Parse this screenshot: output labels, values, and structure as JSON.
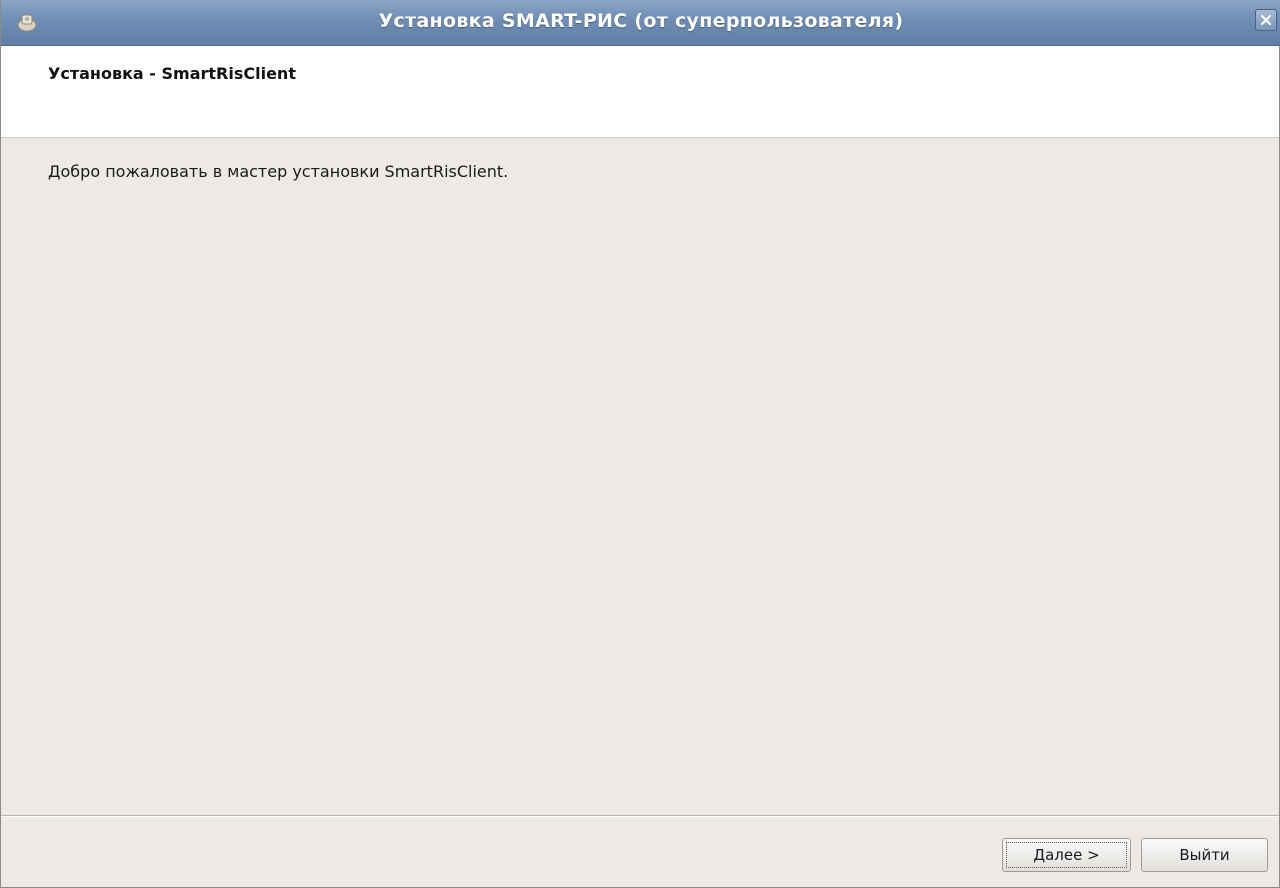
{
  "window": {
    "title": "Установка SMART-РИС (от суперпользователя)",
    "app_icon": "installer-icon",
    "close_icon": "close-icon"
  },
  "header": {
    "title": "Установка - SmartRisClient"
  },
  "main": {
    "welcome_text": "Добро пожаловать в мастер установки SmartRisClient."
  },
  "buttons": {
    "next_mnemonic": "Д",
    "next_rest": "алее >",
    "exit_label": "Выйти"
  },
  "colors": {
    "titlebar": "#6f8db4",
    "background": "#edeae6",
    "header_bg": "#ffffff"
  }
}
